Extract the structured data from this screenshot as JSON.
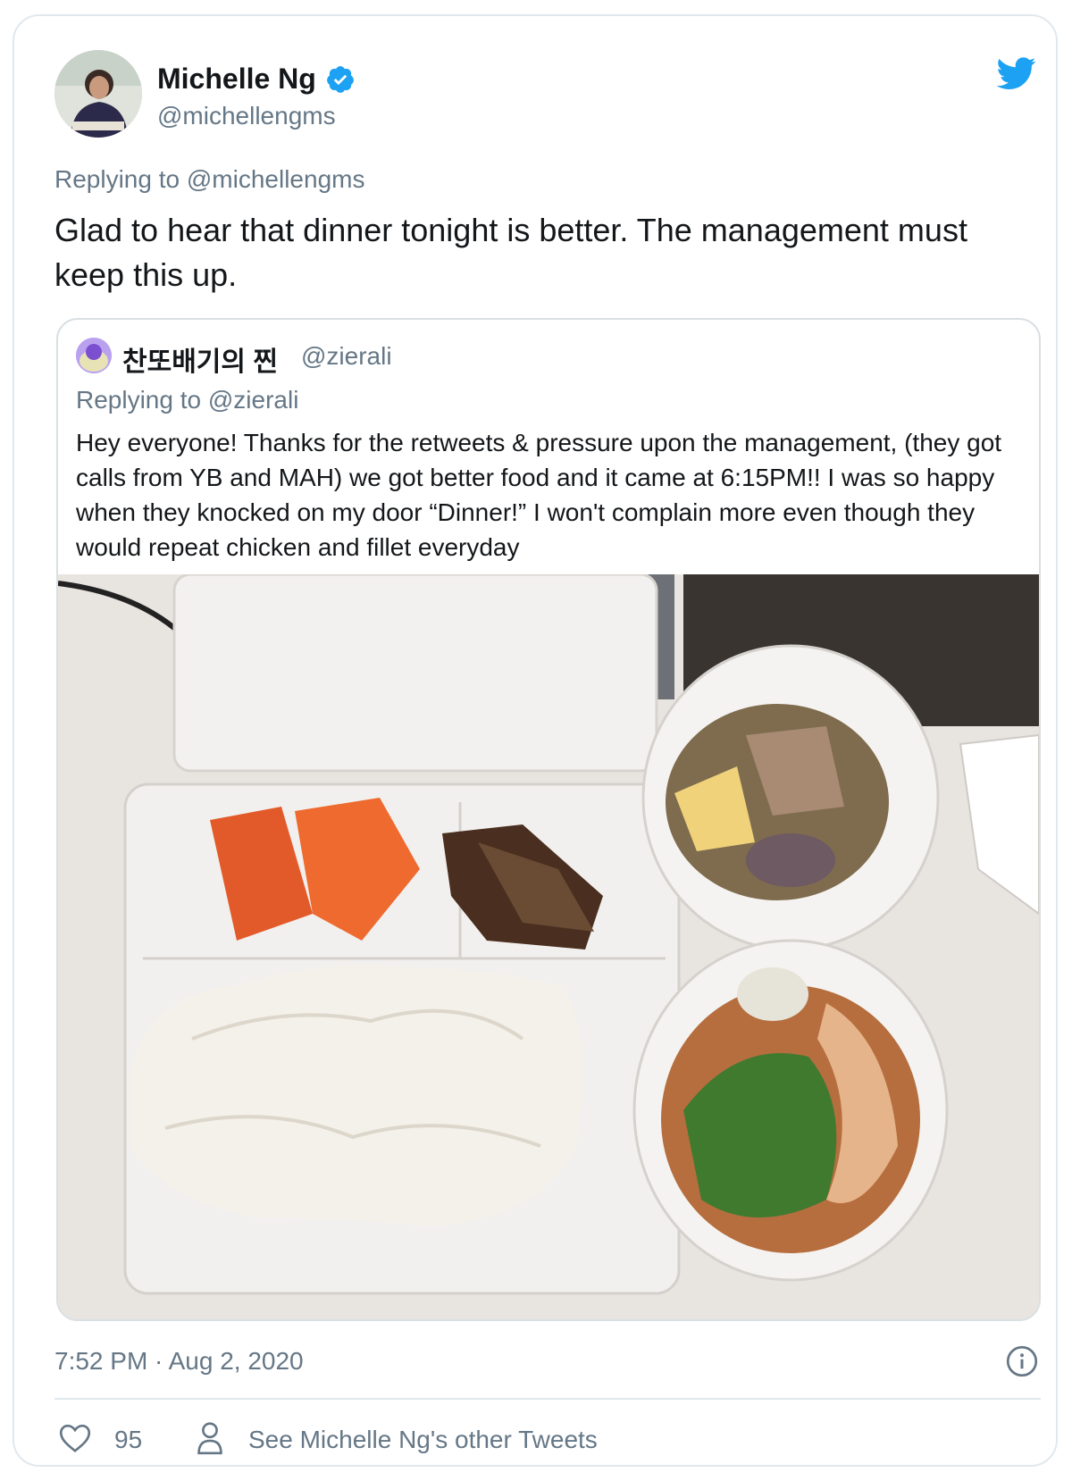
{
  "tweet": {
    "author": {
      "display_name": "Michelle Ng",
      "handle": "@michellengms",
      "verified": true
    },
    "replying_prefix": "Replying to",
    "replying_to": "@michellengms",
    "text": "Glad to hear that dinner tonight is better. The management must keep this up.",
    "timestamp": "7:52 PM · Aug 2, 2020",
    "likes": "95",
    "see_other_tweets": "See Michelle Ng's other Tweets"
  },
  "quoted_tweet": {
    "author": {
      "display_name": "찬또배기의 찐",
      "handle": "@zierali"
    },
    "replying_prefix": "Replying to",
    "replying_to": "@zierali",
    "text": "Hey everyone! Thanks for the retweets & pressure upon the management, (they got calls from YB and MAH) we got better food and it came at 6:15PM!! I was so happy when they knocked on my door “Dinner!” I won't complain more even though they would repeat chicken and fillet everyday",
    "photo": "food-photo"
  },
  "icons": {
    "brand": "twitter-bird-icon",
    "verified": "verified-badge-icon",
    "info": "info-icon",
    "like": "heart-icon",
    "profile": "person-icon"
  },
  "colors": {
    "twitter_blue": "#1da1f2",
    "secondary_text": "#657786",
    "border": "#e1e8ed"
  }
}
